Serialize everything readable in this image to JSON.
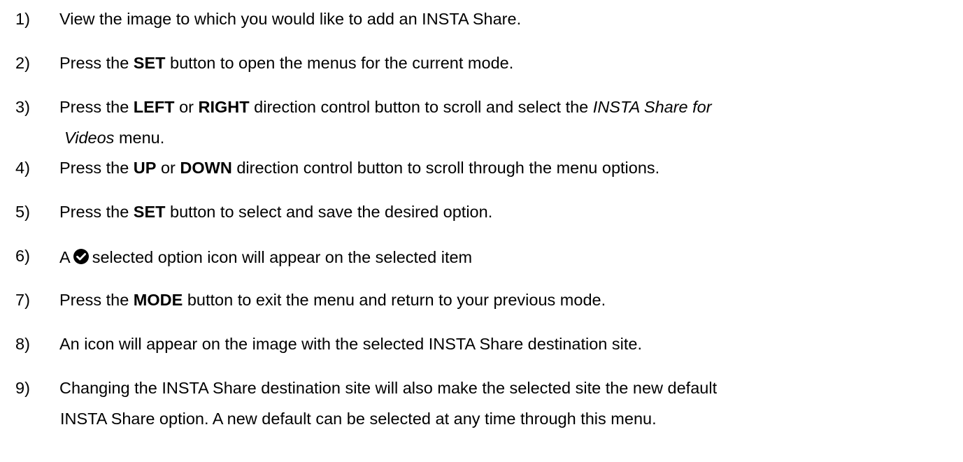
{
  "steps": [
    {
      "number": "1)",
      "parts": [
        {
          "text": "View the image to which you would like to add an INSTA Share."
        }
      ]
    },
    {
      "number": "2)",
      "parts": [
        {
          "text": "Press the "
        },
        {
          "text": "SET",
          "bold": true
        },
        {
          "text": " button to open the menus for the current mode."
        }
      ]
    },
    {
      "number": "3)",
      "parts": [
        {
          "text": "Press the "
        },
        {
          "text": "LEFT",
          "bold": true
        },
        {
          "text": " or "
        },
        {
          "text": "RIGHT",
          "bold": true
        },
        {
          "text": " direction control button to scroll and select the "
        },
        {
          "text": "INSTA Share for",
          "italic": true
        }
      ],
      "line2": [
        {
          "text": "Videos",
          "italic": true
        },
        {
          "text": " menu."
        }
      ]
    },
    {
      "number": "4)",
      "parts": [
        {
          "text": "Press the "
        },
        {
          "text": "UP",
          "bold": true
        },
        {
          "text": " or "
        },
        {
          "text": "DOWN",
          "bold": true
        },
        {
          "text": " direction control button to scroll through the menu options."
        }
      ]
    },
    {
      "number": "5)",
      "parts": [
        {
          "text": "Press the "
        },
        {
          "text": "SET",
          "bold": true
        },
        {
          "text": " button to select and save the desired option."
        }
      ]
    },
    {
      "number": "6)",
      "parts": [
        {
          "text": "A"
        },
        {
          "icon": "check-circle-icon"
        },
        {
          "text": "selected option icon will appear on the selected item"
        }
      ]
    },
    {
      "number": "7)",
      "parts": [
        {
          "text": "Press the "
        },
        {
          "text": "MODE",
          "bold": true
        },
        {
          "text": " button to exit the menu and return to your previous mode."
        }
      ]
    },
    {
      "number": "8)",
      "parts": [
        {
          "text": "An icon will appear on the image with the selected INSTA Share destination site."
        }
      ]
    },
    {
      "number": "9)",
      "parts": [
        {
          "text": "Changing the INSTA Share destination site will also make the selected site the new default"
        }
      ],
      "line2": [
        {
          "text": "INSTA Share option. A new default can be selected at any time through this menu."
        }
      ]
    }
  ],
  "colors": {
    "text": "#000000",
    "background": "#ffffff",
    "icon_fill": "#000000"
  }
}
